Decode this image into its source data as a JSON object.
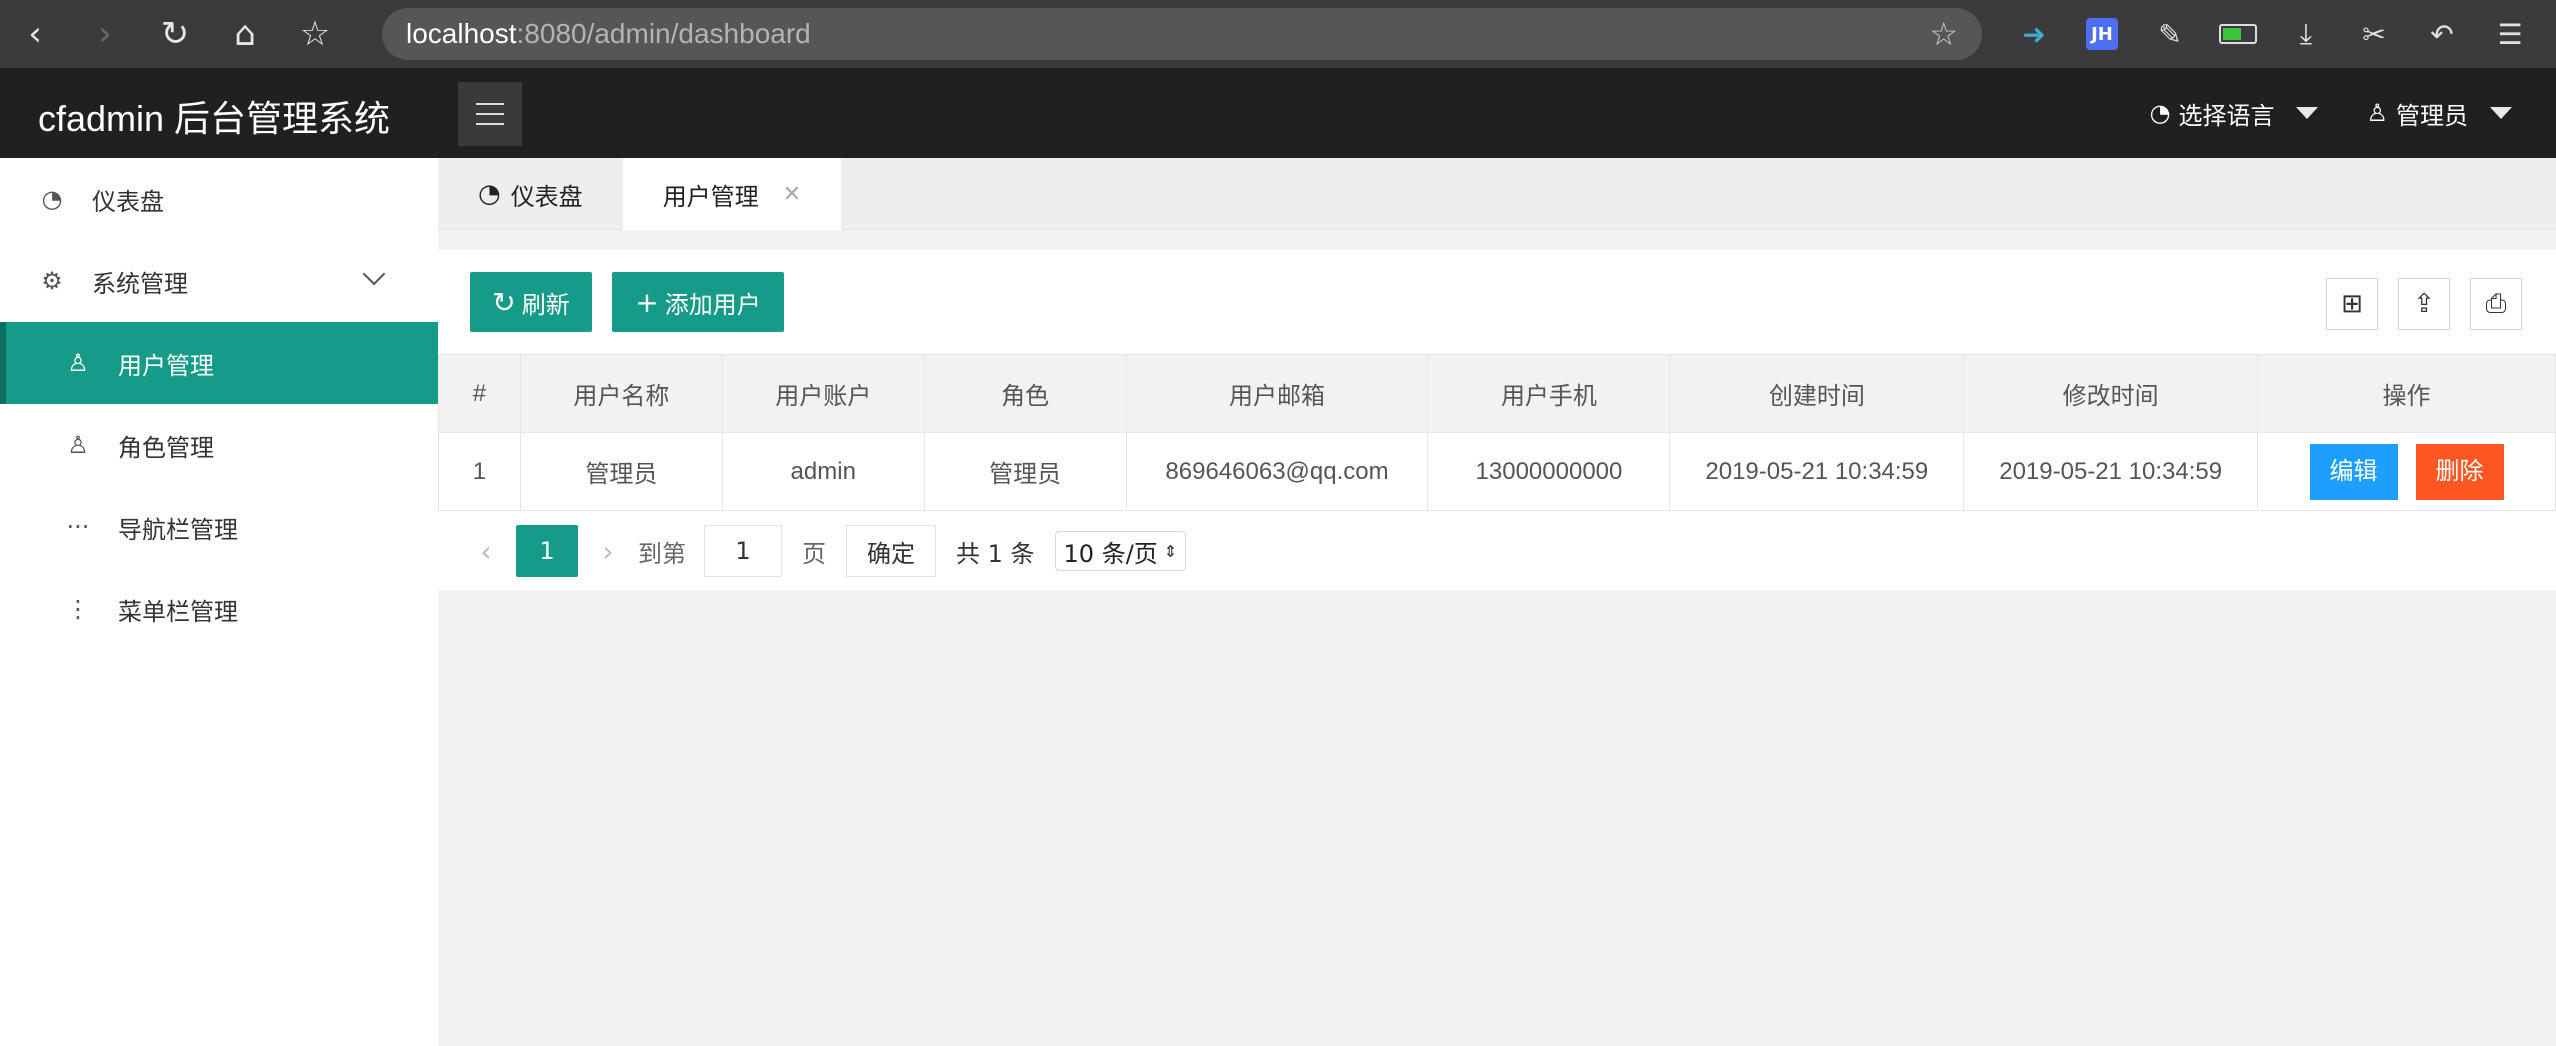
{
  "browser": {
    "url_host": "localhost",
    "url_rest": ":8080/admin/dashboard"
  },
  "header": {
    "logo": "cfadmin 后台管理系统",
    "language": "选择语言",
    "user": "管理员"
  },
  "sidebar": {
    "items": [
      {
        "label": "仪表盘",
        "icon": "dashboard-icon"
      },
      {
        "label": "系统管理",
        "icon": "gear-icon"
      },
      {
        "label": "用户管理",
        "icon": "user-icon"
      },
      {
        "label": "角色管理",
        "icon": "role-icon"
      },
      {
        "label": "导航栏管理",
        "icon": "dots-horizontal-icon"
      },
      {
        "label": "菜单栏管理",
        "icon": "dots-vertical-icon"
      }
    ]
  },
  "tabs": [
    {
      "label": "仪表盘"
    },
    {
      "label": "用户管理"
    }
  ],
  "toolbar": {
    "refresh": "刷新",
    "add_user": "添加用户"
  },
  "table": {
    "headers": [
      "#",
      "用户名称",
      "用户账户",
      "角色",
      "用户邮箱",
      "用户手机",
      "创建时间",
      "修改时间",
      "操作"
    ],
    "rows": [
      [
        "1",
        "管理员",
        "admin",
        "管理员",
        "869646063@qq.com",
        "13000000000",
        "2019-05-21 10:34:59",
        "2019-05-21 10:34:59"
      ]
    ],
    "edit": "编辑",
    "delete": "删除"
  },
  "pager": {
    "current": "1",
    "goto": "到第",
    "input": "1",
    "page": "页",
    "confirm": "确定",
    "total": "共 1 条",
    "per_page": "10 条/页"
  },
  "colors": {
    "accent": "#169b89",
    "edit": "#1e9fff",
    "delete": "#ff5722",
    "header_bg": "#202020"
  }
}
